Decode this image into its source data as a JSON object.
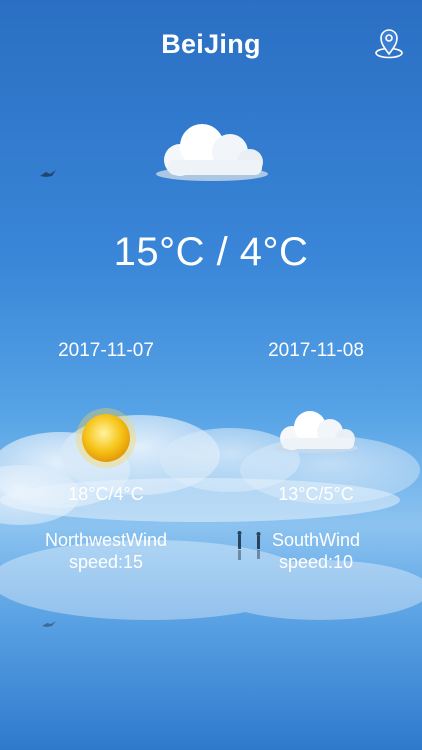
{
  "header": {
    "city": "BeiJing",
    "location_icon": "map-pin-icon"
  },
  "today": {
    "condition_icon": "cloud-icon",
    "temperature": "15°C / 4°C"
  },
  "forecast": [
    {
      "date": "2017-11-07",
      "condition_icon": "sun-icon",
      "range": "18°C/4°C",
      "wind": "NorthwestWind",
      "speed": "speed:15"
    },
    {
      "date": "2017-11-08",
      "condition_icon": "cloud-icon",
      "range": "13°C/5°C",
      "wind": "SouthWind",
      "speed": "speed:10"
    }
  ],
  "colors": {
    "sky_top": "#2a6fc3",
    "sky_horizon": "#8cc3f0",
    "sun": "#f5c216",
    "text": "#ffffff"
  }
}
